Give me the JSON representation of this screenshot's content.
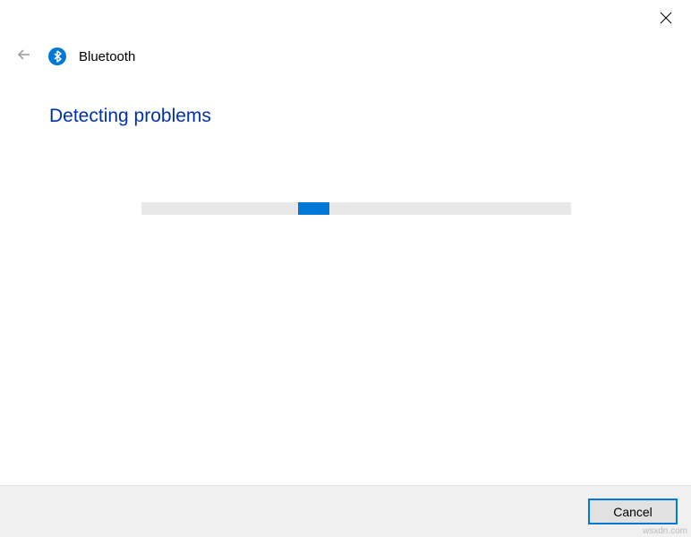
{
  "header": {
    "title": "Bluetooth"
  },
  "main": {
    "heading": "Detecting problems"
  },
  "footer": {
    "cancel_label": "Cancel"
  },
  "watermark": "wsxdn.com"
}
